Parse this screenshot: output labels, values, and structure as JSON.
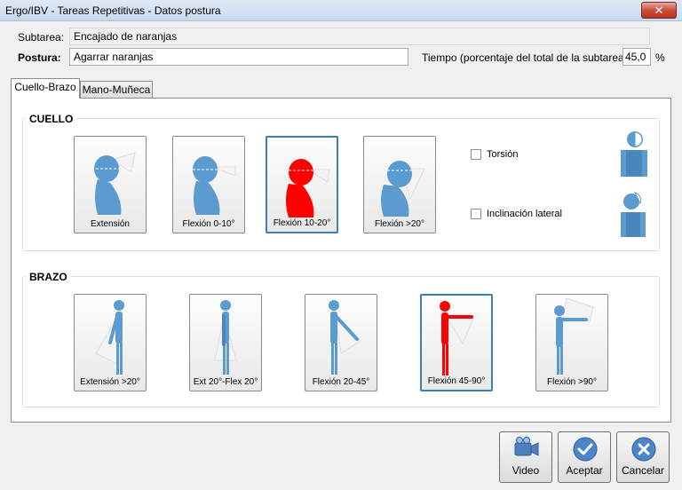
{
  "window": {
    "title": "Ergo/IBV - Tareas Repetitivas - Datos postura",
    "close_glyph": "✕"
  },
  "form": {
    "subtarea_label": "Subtarea:",
    "subtarea_value": "Encajado de naranjas",
    "postura_label": "Postura:",
    "postura_value": "Agarrar naranjas",
    "tiempo_label": "Tiempo (porcentaje del total de la subtarea):",
    "tiempo_value": "45,0",
    "tiempo_unit": "%"
  },
  "tabs": [
    {
      "label": "Cuello-Brazo",
      "active": true
    },
    {
      "label": "Mano-Muñeca",
      "active": false
    }
  ],
  "cuello": {
    "title": "CUELLO",
    "options": [
      {
        "label": "Extensión",
        "selected": false
      },
      {
        "label": "Flexión 0-10°",
        "selected": false
      },
      {
        "label": "Flexión 10-20°",
        "selected": true
      },
      {
        "label": "Flexión >20°",
        "selected": false
      }
    ],
    "checks": [
      {
        "label": "Torsión",
        "checked": false
      },
      {
        "label": "Inclinación lateral",
        "checked": false
      }
    ]
  },
  "brazo": {
    "title": "BRAZO",
    "options": [
      {
        "label": "Extensión >20°",
        "selected": false
      },
      {
        "label": "Ext 20°-Flex 20°",
        "selected": false
      },
      {
        "label": "Flexión 20-45°",
        "selected": false
      },
      {
        "label": "Flexión 45-90°",
        "selected": true
      },
      {
        "label": "Flexión >90°",
        "selected": false
      }
    ]
  },
  "buttons": {
    "video": "Video",
    "aceptar": "Aceptar",
    "cancelar": "Cancelar"
  },
  "colors": {
    "figure_blue": "#5b9bd0",
    "figure_selected": "#ff0000",
    "accent_button": "#3c7fb1"
  }
}
